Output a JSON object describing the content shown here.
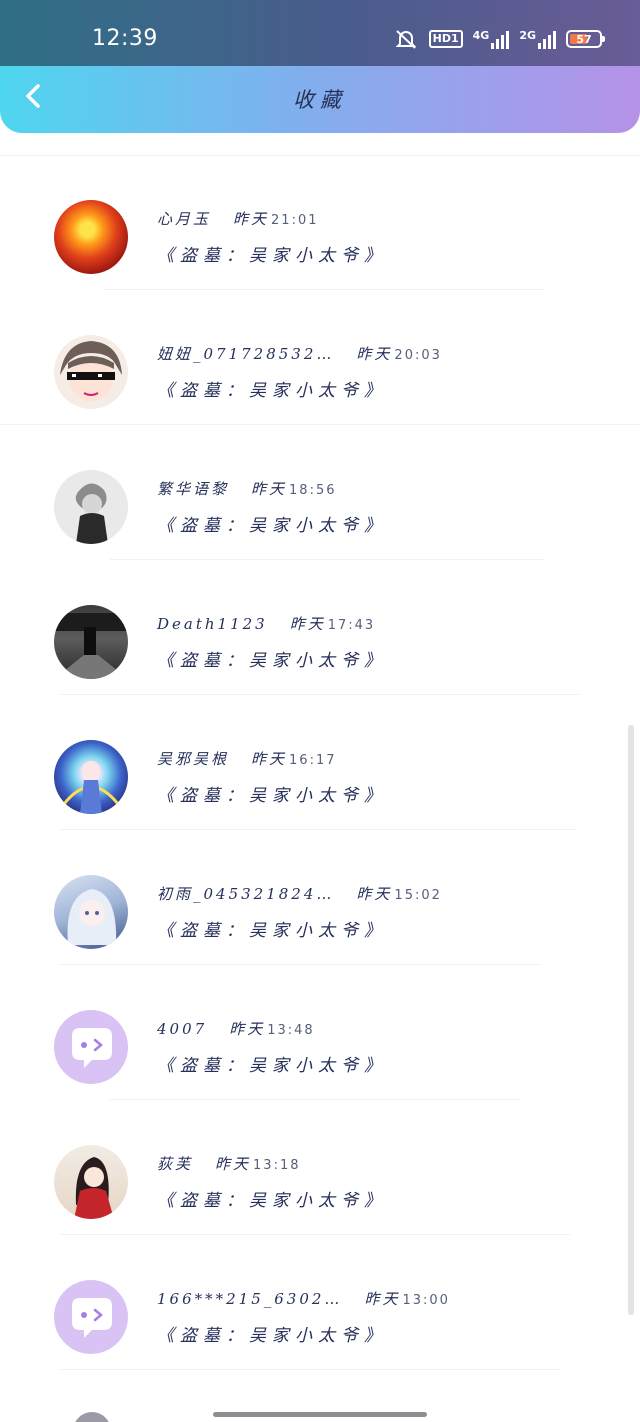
{
  "status_bar": {
    "time": "12:39",
    "hd_label": "HD1",
    "net1": "4G",
    "net2": "2G",
    "battery": "57"
  },
  "header": {
    "title": "收藏"
  },
  "items": [
    {
      "name": "心月玉",
      "day": "昨天",
      "time": "21:01",
      "work": "《盗墓：吴家小太爷》",
      "avatar": "flower-fire-avatar"
    },
    {
      "name": "妞妞_071728532…",
      "day": "昨天",
      "time": "20:03",
      "work": "《盗墓：吴家小太爷》",
      "avatar": "sunglasses-boy-avatar"
    },
    {
      "name": "繁华语黎",
      "day": "昨天",
      "time": "18:56",
      "work": "《盗墓：吴家小太爷》",
      "avatar": "sketch-boy-avatar"
    },
    {
      "name": "Death1123",
      "day": "昨天",
      "time": "17:43",
      "work": "《盗墓：吴家小太爷》",
      "avatar": "dark-street-avatar"
    },
    {
      "name": "吴邪吴根",
      "day": "昨天",
      "time": "16:17",
      "work": "《盗墓：吴家小太爷》",
      "avatar": "colorful-character-avatar"
    },
    {
      "name": "初雨_045321824…",
      "day": "昨天",
      "time": "15:02",
      "work": "《盗墓：吴家小太爷》",
      "avatar": "silver-hair-girl-avatar"
    },
    {
      "name": "4007",
      "day": "昨天",
      "time": "13:48",
      "work": "《盗墓：吴家小太爷》",
      "avatar": "default-chat-avatar"
    },
    {
      "name": "荻芙",
      "day": "昨天",
      "time": "13:18",
      "work": "《盗墓：吴家小太爷》",
      "avatar": "red-robe-avatar"
    },
    {
      "name": "166***215_6302…",
      "day": "昨天",
      "time": "13:00",
      "work": "《盗墓：吴家小太爷》",
      "avatar": "default-chat-avatar"
    }
  ],
  "colors": {
    "header_start": "#4fd6ef",
    "header_end": "#b592e8",
    "text": "#26305a",
    "default_avatar_bg": "#d9c2f4",
    "default_avatar_icon": "#a47ee6"
  }
}
